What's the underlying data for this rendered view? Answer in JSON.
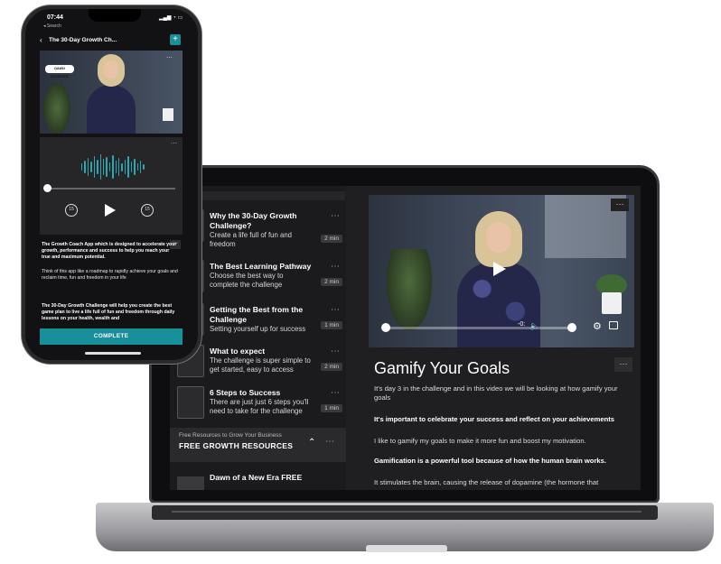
{
  "laptop": {
    "sidebar": {
      "lessons": [
        {
          "title": "Why the 30-Day Growth Challenge?",
          "subtitle": "Create a life full of fun and freedom",
          "duration": "2 min"
        },
        {
          "title": "The Best Learning Pathway",
          "subtitle": "Choose the best way to complete the challenge",
          "duration": "2 min"
        },
        {
          "title": "Getting the Best from the Challenge",
          "subtitle": "Setting yourself up for success",
          "duration": "1 min"
        },
        {
          "title": "What to expect",
          "subtitle": "The challenge is super simple to get started, easy to access",
          "duration": "2 min"
        },
        {
          "title": "6 Steps to Success",
          "subtitle": "There are just just 6 steps you'll need to take for the challenge",
          "duration": "1 min"
        }
      ],
      "resources_label": "Free Resources to Grow Your Business",
      "resources_title": "FREE GROWTH RESOURCES",
      "next_lesson": "Dawn of a New Era FREE"
    },
    "lesson": {
      "title": "Gamify Your Goals",
      "paragraphs": [
        "It's day 3 in the challenge and in this video we will be looking at how gamify your goals",
        "It's important to celebrate your success and reflect on your achievements",
        "I like to gamify my goals to make it more fun and boost my motivation.",
        "Gamification is a powerful tool because of how the human brain works.",
        "It stimulates the brain, causing the release of dopamine (the hormone that"
      ]
    },
    "video": {
      "time": "-0:"
    }
  },
  "phone": {
    "status_time": "07:44",
    "status_sub": "◂ Search",
    "nav_title": "The 30-Day Growth Ch...",
    "logo_text": "DAWN MCGRUER",
    "paragraphs": [
      "The Growth Coach App which is designed to accelerate your growth, performance and success to help you reach your true and maximum potential.",
      "Think of this app like a roadmap to rapidly achieve your goals and reclaim time, fun and freedom in your life",
      "The 30-Day Growth Challenge will help you create the best game plan to live a life full of fun and freedom through daily lessons on your health, wealth and"
    ],
    "complete_label": "COMPLETE",
    "rewind_label": "15",
    "forward_label": "15"
  },
  "colors": {
    "accent": "#17909b",
    "waveform": "#2aa7b4"
  }
}
